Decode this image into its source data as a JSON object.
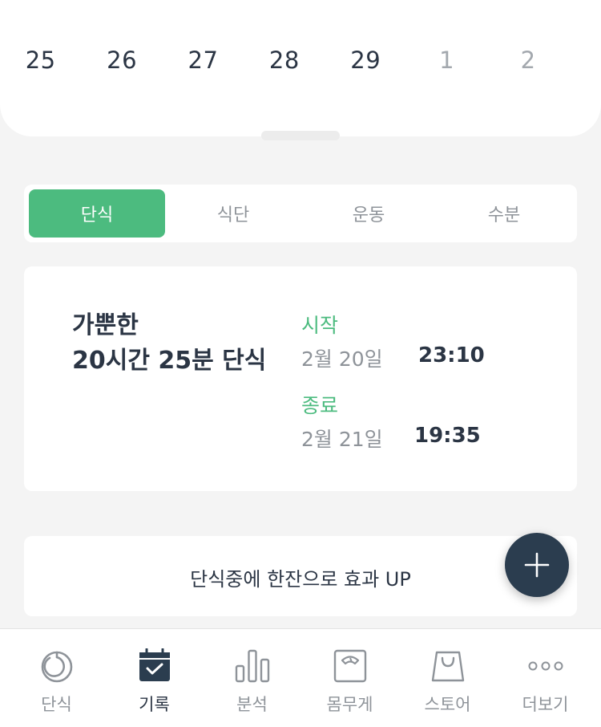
{
  "calendar": {
    "dates": [
      {
        "day": "25",
        "dim": false
      },
      {
        "day": "26",
        "dim": false
      },
      {
        "day": "27",
        "dim": false
      },
      {
        "day": "28",
        "dim": false
      },
      {
        "day": "29",
        "dim": false
      },
      {
        "day": "1",
        "dim": true
      },
      {
        "day": "2",
        "dim": true
      }
    ]
  },
  "tabs": {
    "items": [
      "단식",
      "식단",
      "운동",
      "수분"
    ],
    "active_index": 0
  },
  "fast_card": {
    "title_line1": "가뿐한",
    "title_line2": "20시간 25분 단식",
    "start_label": "시작",
    "start_date": "2월 20일",
    "start_time": "23:10",
    "end_label": "종료",
    "end_date": "2월 21일",
    "end_time": "19:35"
  },
  "promo": {
    "text": "단식중에 한잔으로 효과 UP"
  },
  "fab": {
    "icon": "plus-icon"
  },
  "bottom_nav": {
    "items": [
      {
        "label": "단식",
        "icon": "timer-icon"
      },
      {
        "label": "기록",
        "icon": "calendar-check-icon"
      },
      {
        "label": "분석",
        "icon": "bar-chart-icon"
      },
      {
        "label": "몸무게",
        "icon": "scale-icon"
      },
      {
        "label": "스토어",
        "icon": "shopping-bag-icon"
      },
      {
        "label": "더보기",
        "icon": "more-dots-icon"
      }
    ],
    "active_index": 1
  },
  "colors": {
    "accent_green": "#4cbb7f",
    "dark_navy": "#2b3d4f",
    "text_gray": "#8e9399"
  }
}
